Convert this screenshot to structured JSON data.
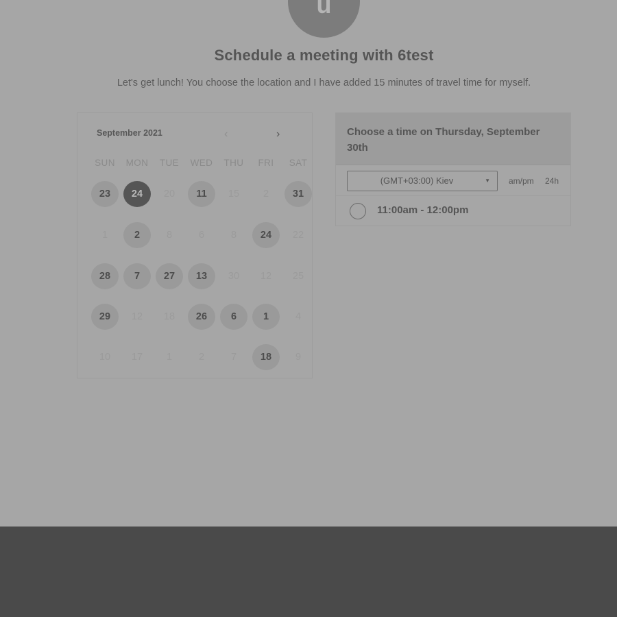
{
  "header": {
    "avatar_initial": "u",
    "title": "Schedule a meeting with 6test",
    "description": "Let's get lunch! You choose the location and I have added 15 minutes of travel time for myself."
  },
  "calendar": {
    "month_label": "September 2021",
    "weekdays": [
      "SUN",
      "MON",
      "TUE",
      "WED",
      "THU",
      "FRI",
      "SAT"
    ],
    "weeks": [
      [
        {
          "d": "23",
          "s": "avail"
        },
        {
          "d": "24",
          "s": "selected"
        },
        {
          "d": "20",
          "s": "muted"
        },
        {
          "d": "11",
          "s": "avail"
        },
        {
          "d": "15",
          "s": "muted"
        },
        {
          "d": "2",
          "s": "muted"
        },
        {
          "d": "31",
          "s": "avail"
        }
      ],
      [
        {
          "d": "1",
          "s": "muted"
        },
        {
          "d": "2",
          "s": "avail"
        },
        {
          "d": "8",
          "s": "muted"
        },
        {
          "d": "6",
          "s": "muted"
        },
        {
          "d": "8",
          "s": "muted"
        },
        {
          "d": "24",
          "s": "avail"
        },
        {
          "d": "22",
          "s": "muted"
        }
      ],
      [
        {
          "d": "28",
          "s": "avail"
        },
        {
          "d": "7",
          "s": "avail"
        },
        {
          "d": "27",
          "s": "avail"
        },
        {
          "d": "13",
          "s": "avail"
        },
        {
          "d": "30",
          "s": "muted"
        },
        {
          "d": "12",
          "s": "muted"
        },
        {
          "d": "25",
          "s": "muted"
        }
      ],
      [
        {
          "d": "29",
          "s": "avail"
        },
        {
          "d": "12",
          "s": "muted"
        },
        {
          "d": "18",
          "s": "muted"
        },
        {
          "d": "26",
          "s": "avail"
        },
        {
          "d": "6",
          "s": "avail"
        },
        {
          "d": "1",
          "s": "avail"
        },
        {
          "d": "4",
          "s": "muted"
        }
      ],
      [
        {
          "d": "10",
          "s": "muted"
        },
        {
          "d": "17",
          "s": "muted"
        },
        {
          "d": "1",
          "s": "muted"
        },
        {
          "d": "2",
          "s": "muted"
        },
        {
          "d": "7",
          "s": "muted"
        },
        {
          "d": "18",
          "s": "avail"
        },
        {
          "d": "9",
          "s": "muted"
        }
      ]
    ]
  },
  "time_panel": {
    "heading": "Choose a time on Thursday, September 30th",
    "timezone": "(GMT+03:00) Kiev",
    "format_ampm": "am/pm",
    "format_24h": "24h",
    "slots": [
      {
        "label": "11:00am - 12:00pm"
      }
    ]
  },
  "colors": {
    "background": "#a6a6a6",
    "bottom_band": "#4a4a4a",
    "selected_day": "#555555",
    "available_day": "#9a9a9a"
  }
}
